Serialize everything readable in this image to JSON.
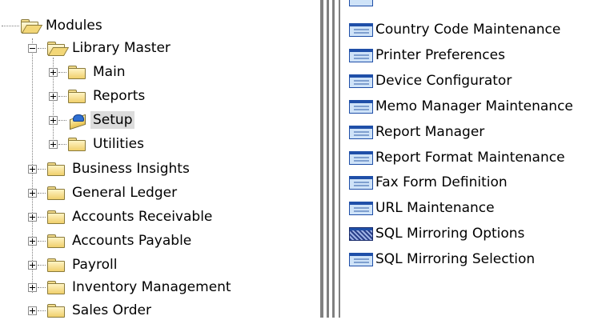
{
  "tree": {
    "root": {
      "label": "Modules"
    },
    "library_master": {
      "label": "Library Master"
    },
    "library_children": [
      {
        "label": "Main"
      },
      {
        "label": "Reports"
      },
      {
        "label": "Setup",
        "selected": true
      },
      {
        "label": "Utilities"
      }
    ],
    "modules": [
      {
        "label": "Business Insights"
      },
      {
        "label": "General Ledger"
      },
      {
        "label": "Accounts Receivable"
      },
      {
        "label": "Accounts Payable"
      },
      {
        "label": "Payroll"
      },
      {
        "label": "Inventory Management"
      },
      {
        "label": "Sales Order"
      }
    ]
  },
  "list": {
    "items": [
      {
        "label": "Country Code Maintenance",
        "icon": "form-icon"
      },
      {
        "label": "Printer Preferences",
        "icon": "form-icon"
      },
      {
        "label": "Device Configurator",
        "icon": "form-icon"
      },
      {
        "label": "Memo Manager Maintenance",
        "icon": "form-icon"
      },
      {
        "label": "Report Manager",
        "icon": "form-icon"
      },
      {
        "label": "Report Format Maintenance",
        "icon": "form-icon"
      },
      {
        "label": "Fax Form Definition",
        "icon": "form-icon"
      },
      {
        "label": "URL Maintenance",
        "icon": "form-icon"
      },
      {
        "label": "SQL Mirroring Options",
        "icon": "mirror-options-icon"
      },
      {
        "label": "SQL Mirroring Selection",
        "icon": "form-icon"
      }
    ]
  }
}
